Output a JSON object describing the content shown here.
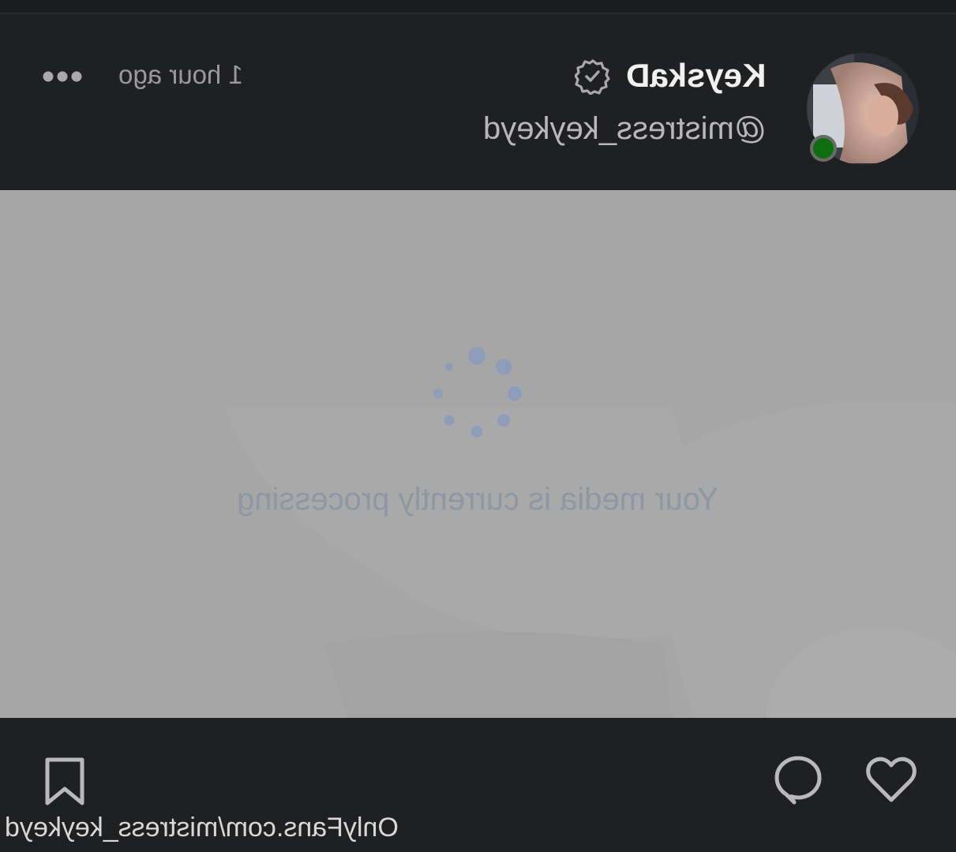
{
  "header": {
    "display_name": "KeyskaD",
    "handle": "@mistress_keykeyd",
    "timestamp": "1 hour ago",
    "verified_icon": "verified-badge-icon",
    "more_icon": "more-dots-icon"
  },
  "media": {
    "status_text": "Your media is currently processing",
    "spinner_icon": "loading-spinner-icon"
  },
  "actions": {
    "bookmark_icon": "bookmark-icon",
    "comment_icon": "comment-icon",
    "like_icon": "heart-icon"
  },
  "watermark": "OnlyFans.com/mistress_keykeyd",
  "colors": {
    "background": "#1f2022",
    "media_placeholder": "#a6a6a6",
    "online": "#0f6e12",
    "spinner": "#8d9cb8"
  }
}
